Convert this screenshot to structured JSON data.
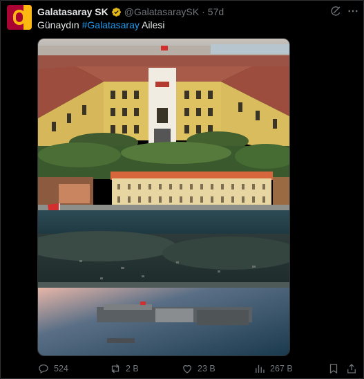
{
  "tweet": {
    "author_name": "Galatasaray SK",
    "handle": "@GalatasaraySK",
    "separator": "·",
    "time": "57d",
    "text_prefix": "Günaydın ",
    "hashtag": "#Galatasaray",
    "text_suffix": " Ailesi"
  },
  "actions": {
    "replies": "524",
    "reposts": "2 B",
    "likes": "23 B",
    "views": "267 B"
  },
  "colors": {
    "accent": "#1d9bf0",
    "verified_badge": "#e2b719",
    "muted": "#71767b",
    "club_red": "#a90432",
    "club_yellow": "#fdb912"
  },
  "icons": [
    "verified-badge-icon",
    "grok-icon",
    "more-icon",
    "reply-icon",
    "repost-icon",
    "like-icon",
    "views-icon",
    "bookmark-icon",
    "share-icon"
  ]
}
